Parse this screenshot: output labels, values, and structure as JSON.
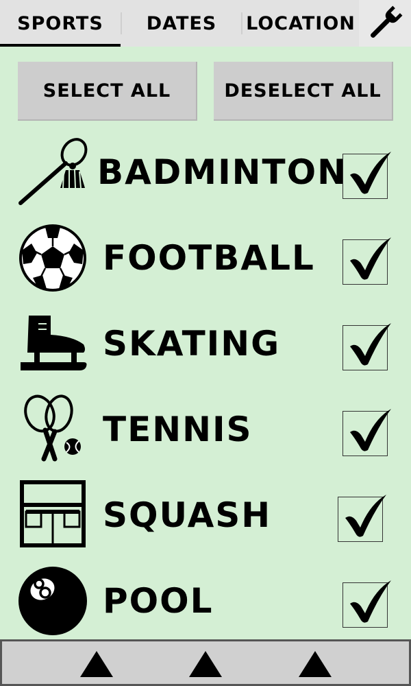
{
  "tabs": {
    "sports": "SPORTS",
    "dates": "DATES",
    "location": "LOCATION",
    "active": "sports"
  },
  "settings_icon": "wrench-icon",
  "actions": {
    "select_all": "SELECT ALL",
    "deselect_all": "DESELECT ALL"
  },
  "sports": [
    {
      "label": "BADMINTON",
      "icon": "badminton-icon",
      "checked": true
    },
    {
      "label": "FOOTBALL",
      "icon": "football-icon",
      "checked": true
    },
    {
      "label": "SKATING",
      "icon": "skate-icon",
      "checked": true
    },
    {
      "label": "TENNIS",
      "icon": "tennis-icon",
      "checked": true
    },
    {
      "label": "SQUASH",
      "icon": "squash-court-icon",
      "checked": true
    },
    {
      "label": "POOL",
      "icon": "eight-ball-icon",
      "checked": true
    }
  ],
  "bottom_bar": {
    "buttons": [
      "up-arrow-icon",
      "up-arrow-icon",
      "up-arrow-icon"
    ]
  },
  "colors": {
    "background": "#d4efd4",
    "tab_bar": "#e2e2e2",
    "button": "#cdcdcd"
  }
}
